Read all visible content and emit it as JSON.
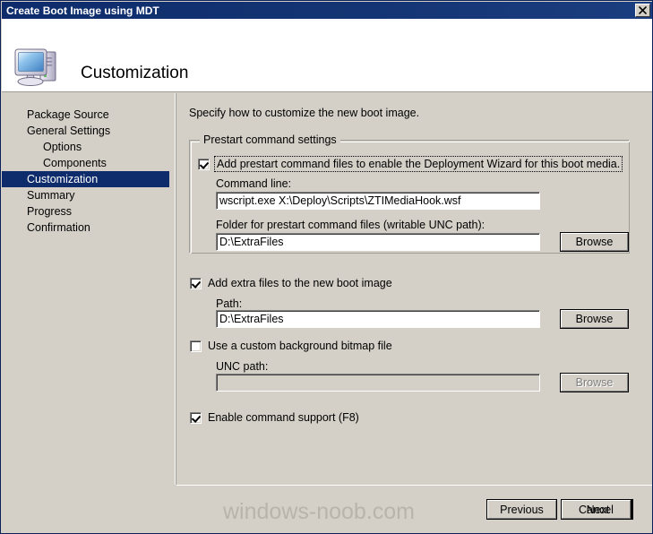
{
  "window": {
    "title": "Create Boot Image using MDT",
    "close_icon": "close-x-icon"
  },
  "header": {
    "title": "Customization",
    "icon": "computer-monitor-icon"
  },
  "sidebar": {
    "items": [
      {
        "label": "Package Source",
        "indent": false,
        "selected": false
      },
      {
        "label": "General Settings",
        "indent": false,
        "selected": false
      },
      {
        "label": "Options",
        "indent": true,
        "selected": false
      },
      {
        "label": "Components",
        "indent": true,
        "selected": false
      },
      {
        "label": "Customization",
        "indent": false,
        "selected": true
      },
      {
        "label": "Summary",
        "indent": false,
        "selected": false
      },
      {
        "label": "Progress",
        "indent": false,
        "selected": false
      },
      {
        "label": "Confirmation",
        "indent": false,
        "selected": false
      }
    ],
    "selection_color": "#0e2c6b"
  },
  "main": {
    "intro": "Specify how to customize the new boot image.",
    "groupbox": {
      "legend": "Prestart command settings",
      "prestart_checkbox": {
        "label": "Add prestart command files to enable the Deployment Wizard for this boot media.",
        "checked": true,
        "focused": true
      },
      "command_line": {
        "label": "Command line:",
        "value": "wscript.exe X:\\Deploy\\Scripts\\ZTIMediaHook.wsf",
        "placeholder": ""
      },
      "folder": {
        "label": "Folder for prestart command files (writable UNC path):",
        "value": "D:\\ExtraFiles",
        "placeholder": "",
        "browse_label": "Browse"
      }
    },
    "extra_files": {
      "checkbox_label": "Add extra files to the new boot image",
      "checked": true,
      "path_label": "Path:",
      "path_value": "D:\\ExtraFiles",
      "browse_label": "Browse"
    },
    "background_bitmap": {
      "checkbox_label": "Use a custom background bitmap file",
      "checked": false,
      "unc_label": "UNC path:",
      "unc_value": "",
      "unc_placeholder": "",
      "browse_label": "Browse",
      "disabled": true
    },
    "command_support": {
      "checkbox_label": "Enable command support (F8)",
      "checked": true
    }
  },
  "footer": {
    "previous_label": "Previous",
    "next_label": "Next",
    "cancel_label": "Cancel",
    "watermark": "windows-noob.com"
  }
}
